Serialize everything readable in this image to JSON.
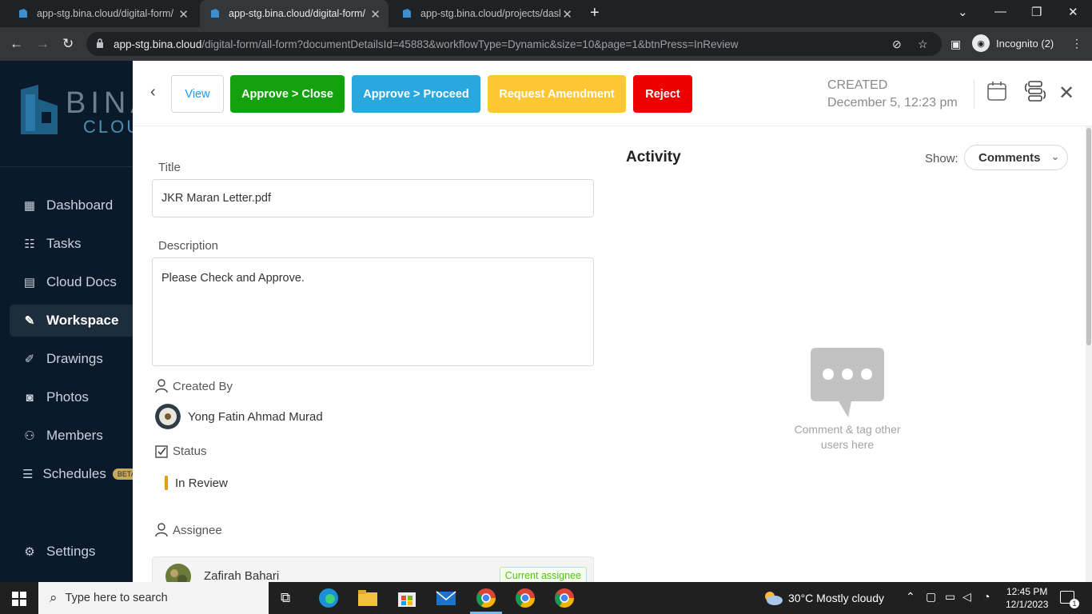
{
  "browser": {
    "tabs": [
      {
        "title": "app-stg.bina.cloud/digital-form/",
        "active": false
      },
      {
        "title": "app-stg.bina.cloud/digital-form/",
        "active": true
      },
      {
        "title": "app-stg.bina.cloud/projects/dasl",
        "active": false
      }
    ],
    "url_host": "app-stg.bina.cloud",
    "url_path": "/digital-form/all-form?documentDetailsId=45883&workflowType=Dynamic&size=10&page=1&btnPress=InReview",
    "incognito_label": "Incognito (2)"
  },
  "logo": {
    "word1": "BINA",
    "word2": "CLOUD"
  },
  "sidebar": {
    "items": [
      {
        "label": "Dashboard",
        "icon": "dashboard-icon"
      },
      {
        "label": "Tasks",
        "icon": "tasks-icon"
      },
      {
        "label": "Cloud Docs",
        "icon": "document-icon"
      },
      {
        "label": "Workspace",
        "icon": "pen-icon",
        "active": true
      },
      {
        "label": "Drawings",
        "icon": "drawing-icon"
      },
      {
        "label": "Photos",
        "icon": "camera-icon"
      },
      {
        "label": "Members",
        "icon": "members-icon"
      },
      {
        "label": "Schedules",
        "icon": "schedule-icon",
        "badge": "BETA"
      },
      {
        "label": "Settings",
        "icon": "gear-icon"
      }
    ]
  },
  "toolbar": {
    "view": "View",
    "approve_close": "Approve > Close",
    "approve_proceed": "Approve > Proceed",
    "request_amendment": "Request Amendment",
    "reject": "Reject",
    "created_label": "CREATED",
    "created_date": "December 5, 12:23 pm"
  },
  "form": {
    "title_label": "Title",
    "title_value": "JKR Maran Letter.pdf",
    "description_label": "Description",
    "description_value": "Please Check and Approve.",
    "created_by_label": "Created By",
    "created_by_name": "Yong Fatin Ahmad Murad",
    "status_label": "Status",
    "status_value": "In Review",
    "assignee_label": "Assignee",
    "assignee_name": "Zafirah Bahari",
    "assignee_badge": "Current assignee"
  },
  "activity": {
    "title": "Activity",
    "show_label": "Show:",
    "show_value": "Comments",
    "empty_line1": "Comment & tag other",
    "empty_line2": "users here"
  },
  "taskbar": {
    "search_placeholder": "Type here to search",
    "weather": "30°C  Mostly cloudy",
    "time": "12:45 PM",
    "date": "12/1/2023",
    "notifications": "1"
  },
  "colors": {
    "approve_close": "#13a10e",
    "approve_proceed": "#29a8e0",
    "request_amendment": "#ffc733",
    "reject": "#ee0000",
    "status_in_review": "#e69c1a",
    "sidebar_bg": "#0b1a2a"
  }
}
